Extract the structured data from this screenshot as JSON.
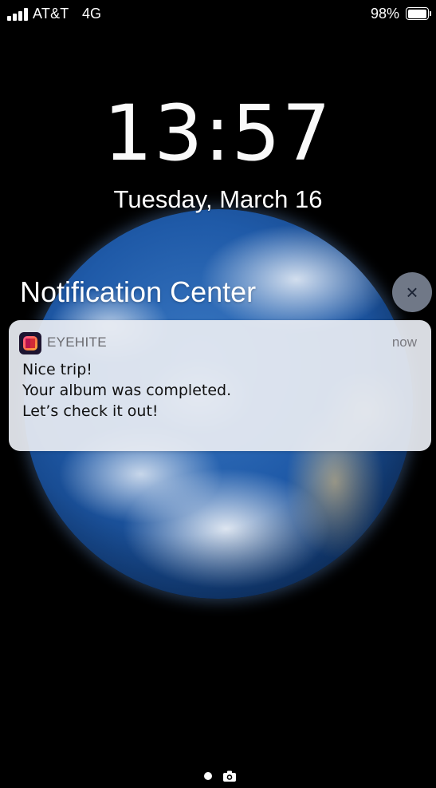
{
  "status_bar": {
    "carrier": "AT&T",
    "network": "4G",
    "battery_percent": "98%",
    "signal_bars": 4,
    "icons": [
      "signal-icon",
      "battery-icon"
    ]
  },
  "lock_screen": {
    "time": "13:57",
    "date": "Tuesday, March 16"
  },
  "notification_center": {
    "title": "Notification Center",
    "close_icon": "×"
  },
  "notification": {
    "app_name": "EYEHITE",
    "time": "now",
    "lines": [
      "Nice trip!",
      "Your album was completed.",
      "Let’s check it out!"
    ],
    "icon_colors": {
      "background": "#1d1430",
      "accent_start": "#ff4f8b",
      "accent_end": "#ffb43a"
    }
  },
  "bottom_bar": {
    "icons": [
      "page-indicator-dot",
      "camera-icon"
    ]
  }
}
